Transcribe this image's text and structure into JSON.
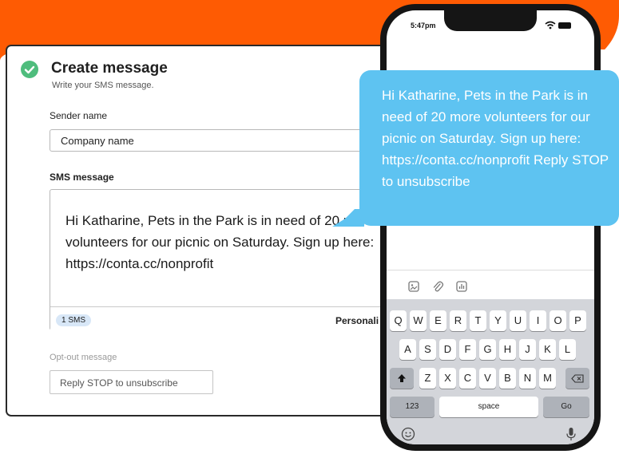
{
  "card": {
    "title": "Create message",
    "subtitle": "Write your SMS message.",
    "sender_label": "Sender name",
    "sender_value": "Company name",
    "sms_label": "SMS message",
    "sms_text": "Hi Katharine, Pets in the Park is in need of 20 more volunteers for our picnic on Saturday. Sign up here: https://conta.cc/nonprofit",
    "sms_count": "1 SMS",
    "personalize_label": "Personali",
    "optout_label": "Opt-out message",
    "optout_value": "Reply STOP to unsubscribe"
  },
  "phone": {
    "time": "5:47pm",
    "bubble_text": "Hi Katharine, Pets in the Park is in need of 20 more volunteers for our picnic on Saturday. Sign up here: https://conta.cc/nonprofit Reply STOP to unsubscribe",
    "keyboard": {
      "row1": [
        "Q",
        "W",
        "E",
        "R",
        "T",
        "Y",
        "U",
        "I",
        "O",
        "P"
      ],
      "row2": [
        "A",
        "S",
        "D",
        "F",
        "G",
        "H",
        "J",
        "K",
        "L"
      ],
      "row3": [
        "Z",
        "X",
        "C",
        "V",
        "B",
        "N",
        "M"
      ],
      "numbers_key": "123",
      "space_key": "space",
      "go_key": "Go"
    }
  },
  "colors": {
    "accent_orange": "#fe5b03",
    "check_green": "#4fbd7d",
    "bubble_blue": "#5ec3f1"
  }
}
